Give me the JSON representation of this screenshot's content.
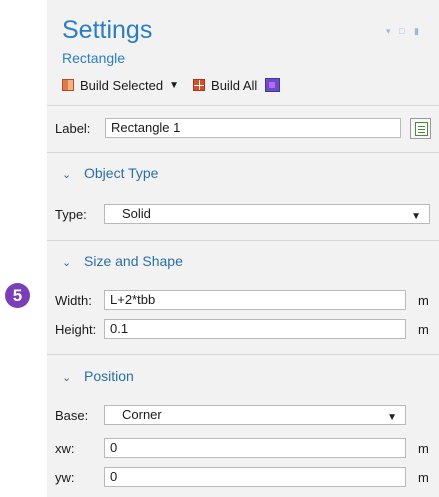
{
  "header": {
    "title": "Settings",
    "subtitle": "Rectangle"
  },
  "window_controls": {
    "dropdown": "▾",
    "maximize": "□",
    "pin": "▮"
  },
  "toolbar": {
    "build_selected": "Build Selected",
    "build_all": "Build All"
  },
  "label_row": {
    "label": "Label:",
    "value": "Rectangle 1"
  },
  "sections": {
    "object_type": {
      "title": "Object Type",
      "type_label": "Type:",
      "type_value": "Solid"
    },
    "size_shape": {
      "title": "Size and Shape",
      "width_label": "Width:",
      "width_value": "L+2*tbb",
      "width_unit": "m",
      "height_label": "Height:",
      "height_value": "0.1",
      "height_unit": "m"
    },
    "position": {
      "title": "Position",
      "base_label": "Base:",
      "base_value": "Corner",
      "xw_label": "xw:",
      "xw_value": "0",
      "xw_unit": "m",
      "yw_label": "yw:",
      "yw_value": "0",
      "yw_unit": "m"
    }
  },
  "badge": {
    "number": "5",
    "color": "#7a3fb8"
  },
  "colors": {
    "accent": "#2b7fc1",
    "panel": "#f2f2f2"
  }
}
